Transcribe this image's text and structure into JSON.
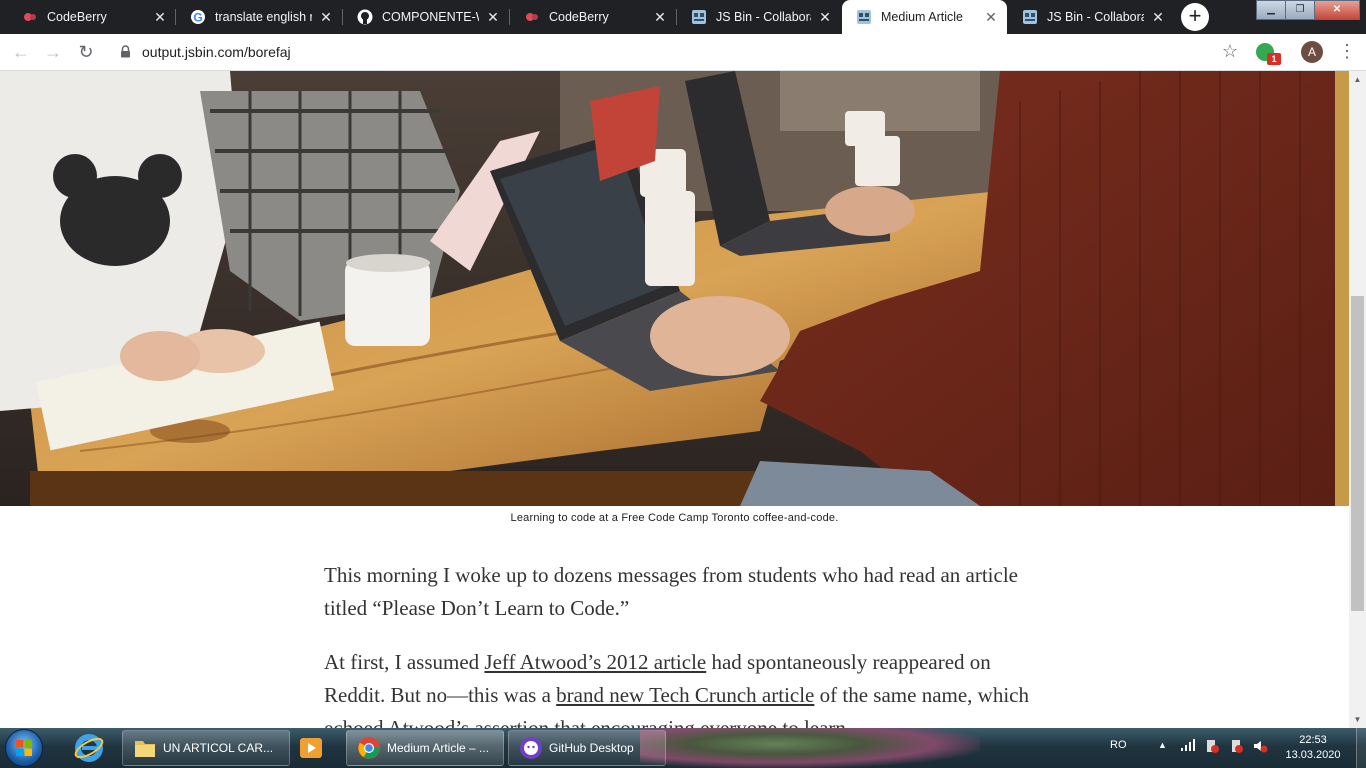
{
  "browser": {
    "tabs": [
      {
        "title": "CodeBerry",
        "favicon": "codeberry-icon",
        "active": false
      },
      {
        "title": "translate english ro",
        "favicon": "google-icon",
        "active": false
      },
      {
        "title": "COMPONENTE-WE",
        "favicon": "github-icon",
        "active": false
      },
      {
        "title": "CodeBerry",
        "favicon": "codeberry-icon",
        "active": false
      },
      {
        "title": "JS Bin - Collaborati",
        "favicon": "jsbin-icon",
        "active": false
      },
      {
        "title": "Medium Article",
        "favicon": "jsbin-icon",
        "active": true
      },
      {
        "title": "JS Bin - Collaborati",
        "favicon": "jsbin-icon",
        "active": false
      }
    ],
    "url": "output.jsbin.com/borefaj",
    "extension_badge": "1",
    "profile_initial": "A"
  },
  "page": {
    "caption": "Learning to code at a Free Code Camp Toronto coffee-and-code.",
    "paragraph1": "This morning I woke up to dozens messages from students who had read an article titled “Please Don’t Learn to Code.”",
    "paragraph2": {
      "part1": "At first, I assumed ",
      "link1": "Jeff Atwood’s 2012 article",
      "part2": " had spontaneously reappeared on Reddit. But no—this was a ",
      "link2": "brand new Tech Crunch article",
      "part3": " of the same name, which echoed Atwood’s assertion that encouraging everyone to learn"
    }
  },
  "taskbar": {
    "buttons": [
      {
        "label": "UN ARTICOL CAR...",
        "icon": "folder-icon"
      },
      {
        "label": "Medium Article – ...",
        "icon": "chrome-icon"
      },
      {
        "label": "GitHub Desktop",
        "icon": "github-desktop-icon"
      }
    ],
    "language": "RO",
    "time": "22:53",
    "date": "13.03.2020"
  },
  "colors": {
    "tab_strip": "#202124",
    "taskbar": "#203541",
    "article_text": "#333333"
  }
}
